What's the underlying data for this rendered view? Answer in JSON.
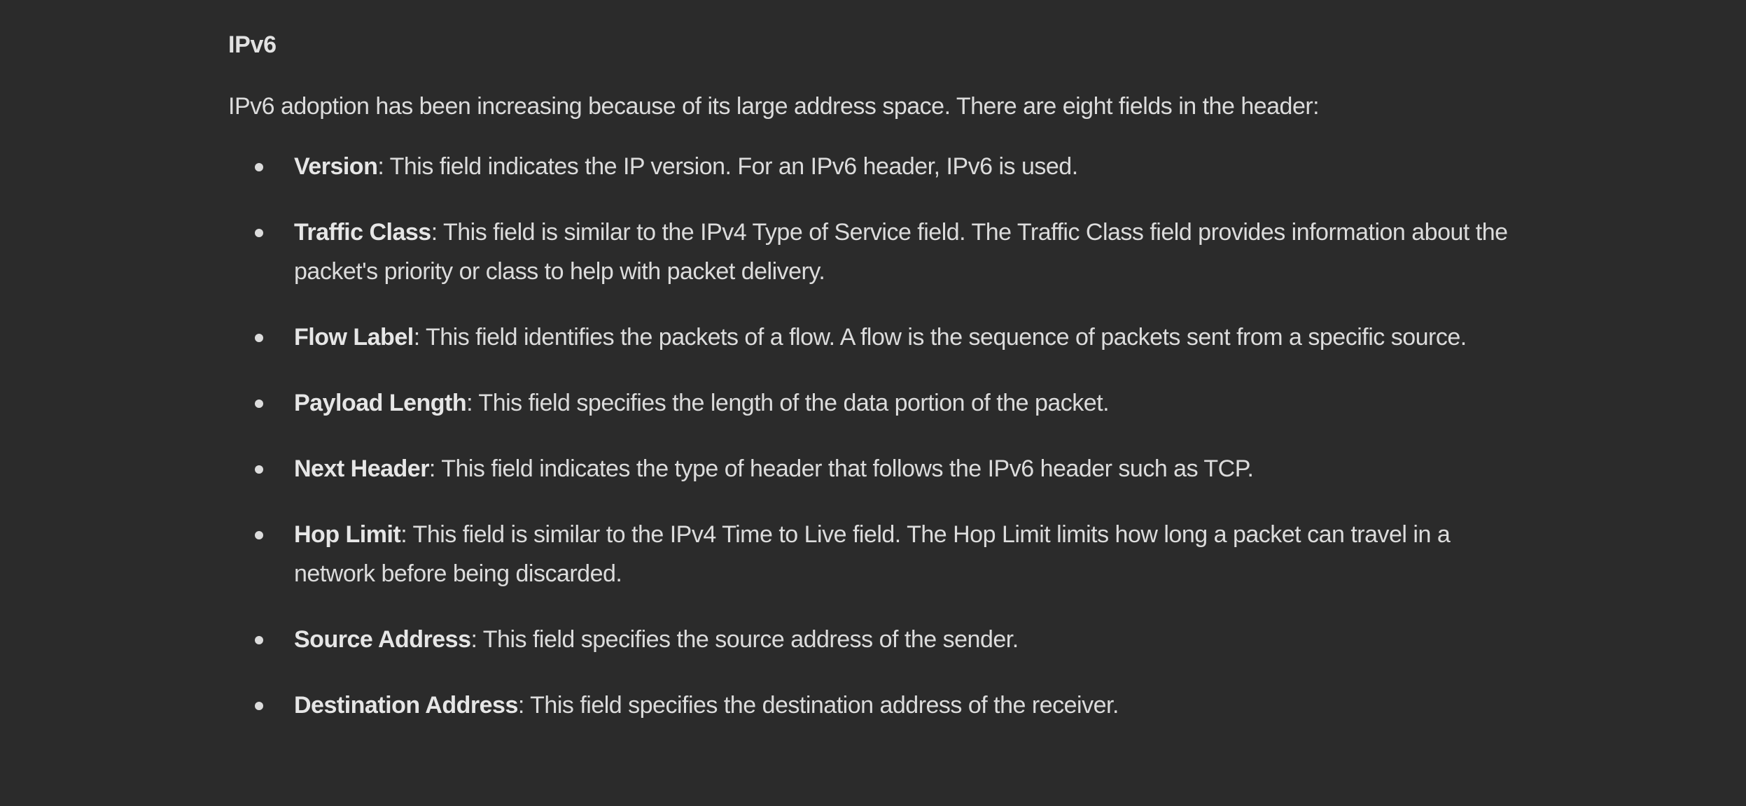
{
  "section": {
    "title": "IPv6",
    "intro": "IPv6 adoption has been increasing because of its large address space. There are eight fields in the header:"
  },
  "fields": [
    {
      "term": "Version",
      "desc": ": This field indicates the IP version. For an IPv6 header, IPv6 is used."
    },
    {
      "term": "Traffic Class",
      "desc": ": This field is similar to the IPv4 Type of Service field. The Traffic Class field provides information about the packet's priority or class to help with packet delivery."
    },
    {
      "term": "Flow Label",
      "desc": ": This field identifies the packets of a flow. A flow is the sequence of packets sent from a specific source."
    },
    {
      "term": "Payload Length",
      "desc": ": This field specifies the length of the data portion of the packet."
    },
    {
      "term": "Next Header",
      "desc": ": This field indicates the type of header that follows the IPv6 header such as TCP."
    },
    {
      "term": "Hop Limit",
      "desc": ": This field is similar to the IPv4 Time to Live field. The Hop Limit limits how long a packet can travel in a network before being discarded."
    },
    {
      "term": "Source Address",
      "desc": ": This field specifies the source address of the sender."
    },
    {
      "term": "Destination Address",
      "desc": ": This field specifies the destination address of the receiver."
    }
  ],
  "colors": {
    "background": "#2b2b2b",
    "text": "#dcdcdc"
  }
}
